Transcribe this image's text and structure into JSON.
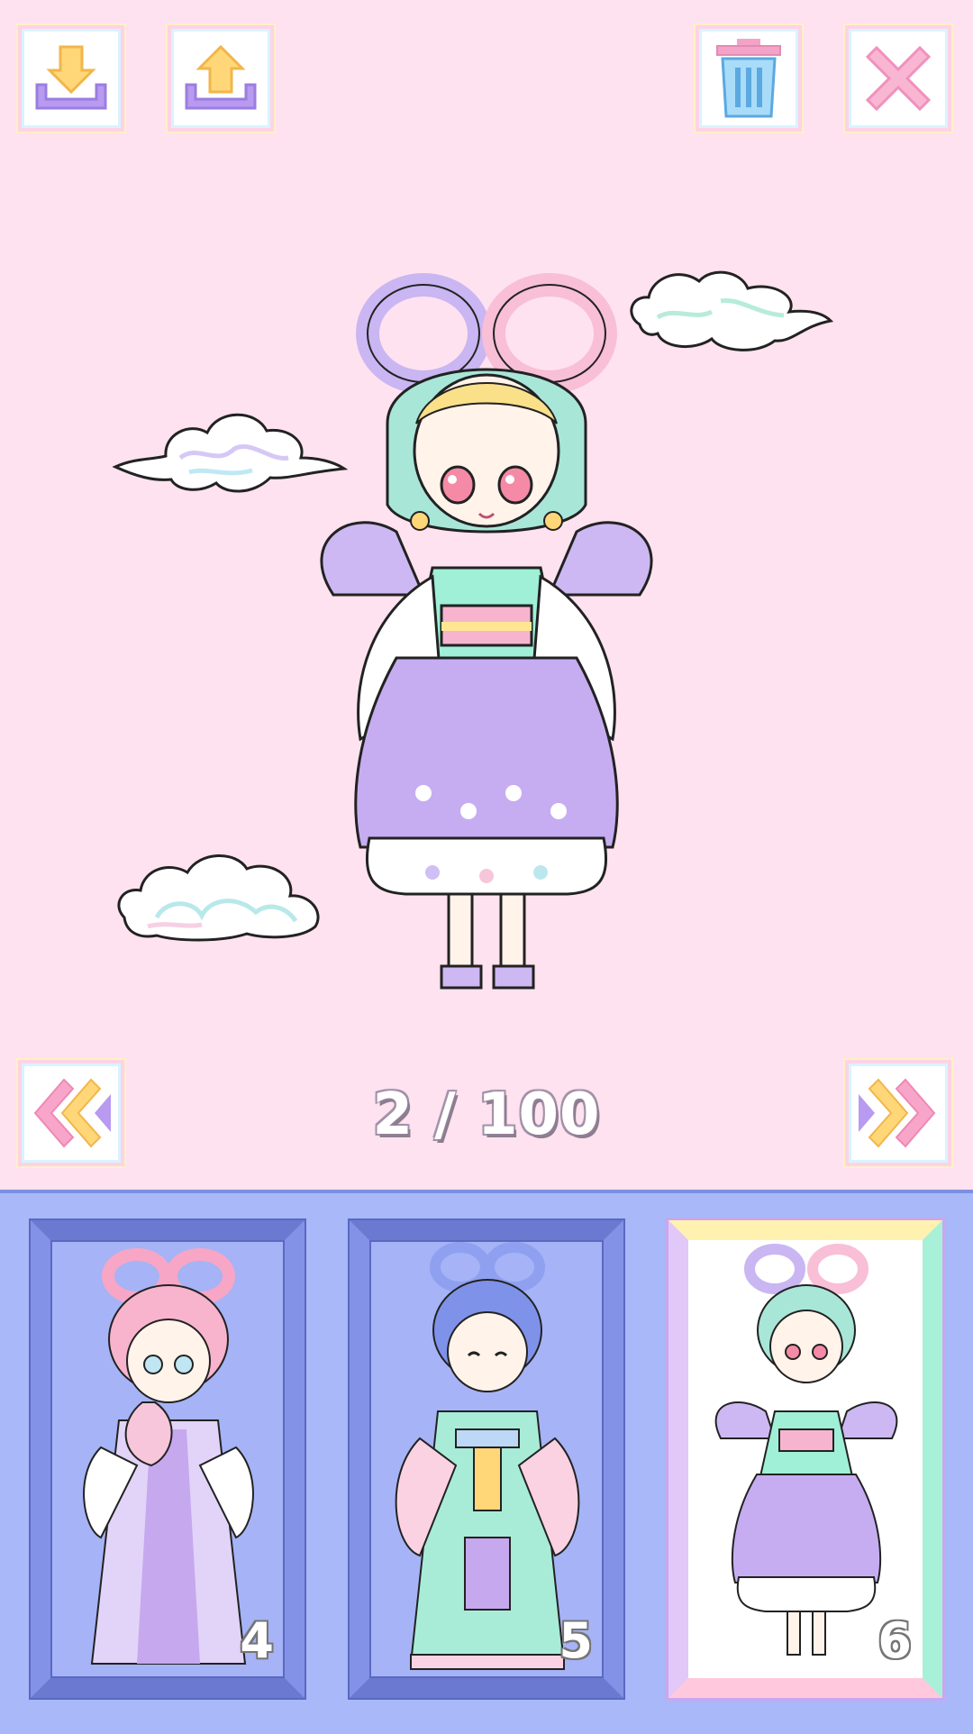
{
  "toolbar": {
    "download_icon": "download-arrow-icon",
    "upload_icon": "upload-arrow-icon",
    "trash_icon": "trash-icon",
    "close_icon": "close-x-icon"
  },
  "pager": {
    "counter": "2 / 100",
    "prev_icon": "double-chevron-left-icon",
    "next_icon": "double-chevron-right-icon"
  },
  "slots": [
    {
      "number": "4",
      "state": "locked"
    },
    {
      "number": "5",
      "state": "locked"
    },
    {
      "number": "6",
      "state": "selected"
    }
  ],
  "colors": {
    "background": "#ffe2ef",
    "tray": "#a8b8f8",
    "tray_frame": "#6b7ad0",
    "accent_pink": "#f3a3c8",
    "accent_purple": "#b59bea"
  }
}
